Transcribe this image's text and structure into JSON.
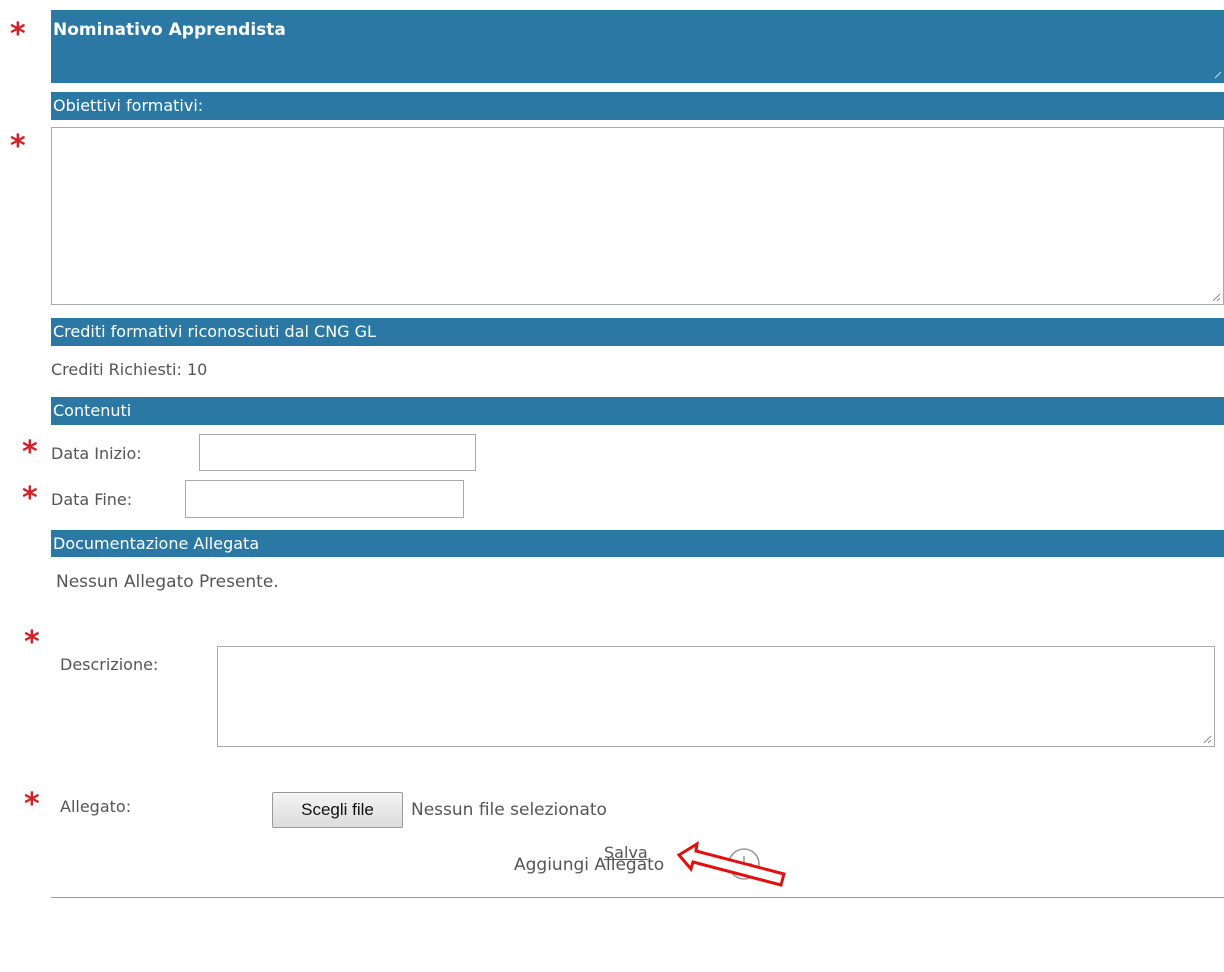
{
  "form": {
    "header_title": "Nominativo Apprendista",
    "objectives_label": "Obiettivi formativi:",
    "credits_section": "Crediti formativi riconosciuti dal CNG GL",
    "credits_required": "Crediti Richiesti: 10",
    "contents_section": "Contenuti",
    "start_date_label": "Data Inizio:",
    "start_date_value": "",
    "end_date_label": "Data Fine:",
    "end_date_value": "",
    "docs_section": "Documentazione Allegata",
    "no_attachments": "Nessun Allegato Presente.",
    "description_label": "Descrizione:",
    "attachment_label": "Allegato:",
    "choose_file_button": "Scegli file",
    "no_file_selected": "Nessun file selezionato",
    "add_attachment": "Aggiungi Allegato",
    "save_link": "Salva",
    "required_marker": "*"
  },
  "colors": {
    "section_bar": "#2a78a3",
    "required": "#d42027",
    "annotation_arrow": "#e01010"
  },
  "icons": {
    "add": "plus-circle-icon",
    "annotation": "red-arrow-icon"
  }
}
